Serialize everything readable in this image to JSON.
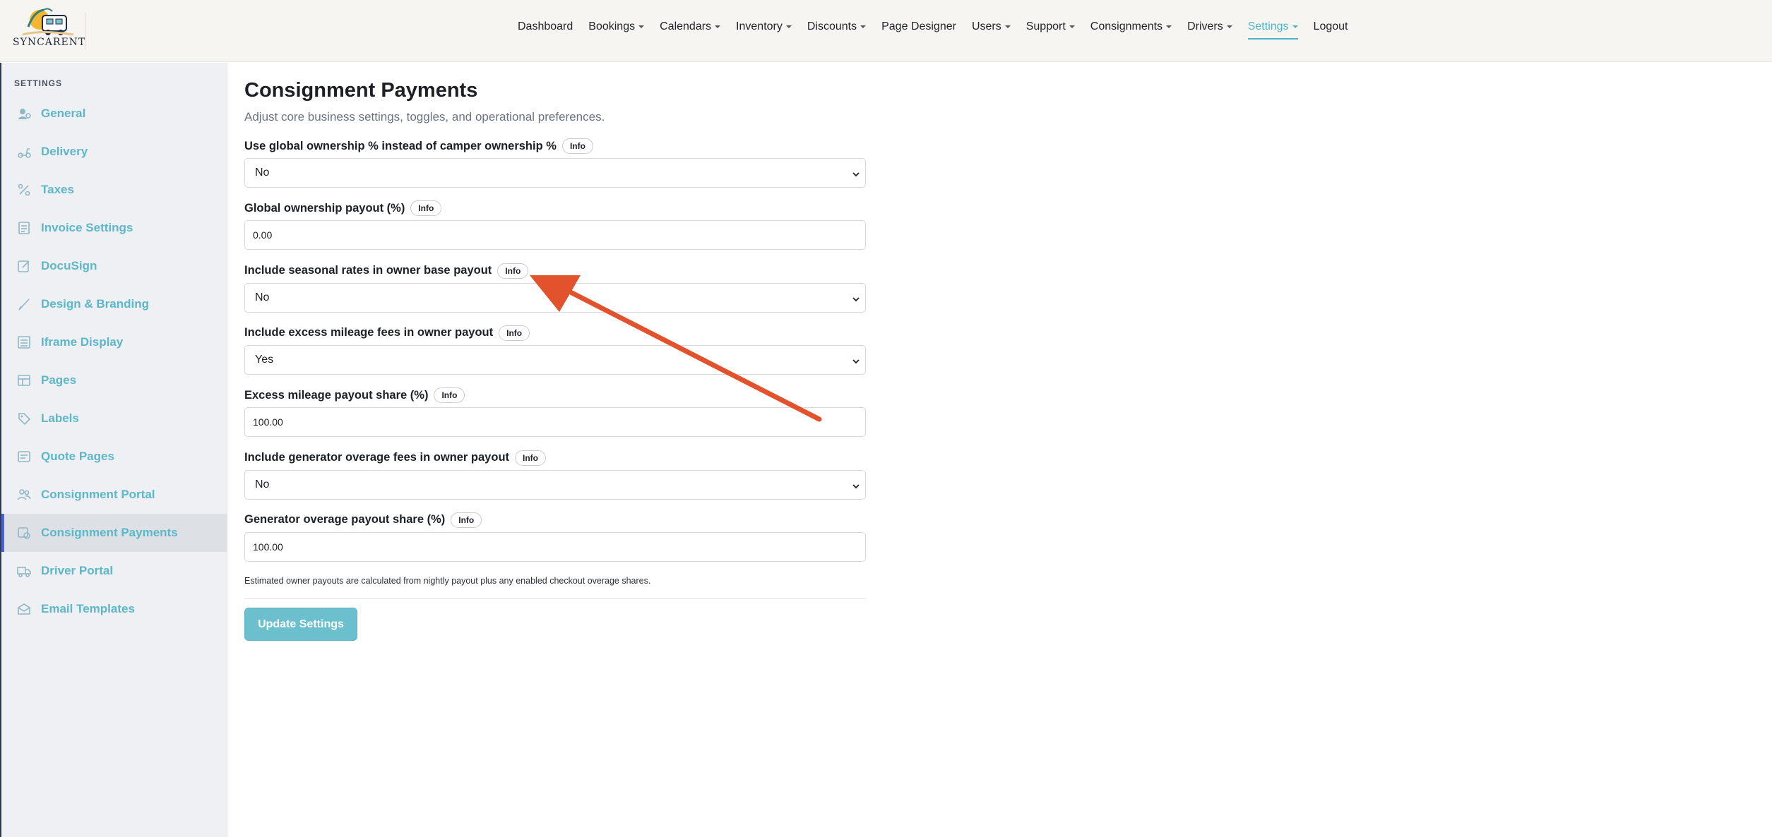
{
  "brand": {
    "name": "SYNCARENT"
  },
  "nav": {
    "items": [
      {
        "label": "Dashboard",
        "caret": false,
        "active": false
      },
      {
        "label": "Bookings",
        "caret": true,
        "active": false
      },
      {
        "label": "Calendars",
        "caret": true,
        "active": false
      },
      {
        "label": "Inventory",
        "caret": true,
        "active": false
      },
      {
        "label": "Discounts",
        "caret": true,
        "active": false
      },
      {
        "label": "Page Designer",
        "caret": false,
        "active": false
      },
      {
        "label": "Users",
        "caret": true,
        "active": false
      },
      {
        "label": "Support",
        "caret": true,
        "active": false
      },
      {
        "label": "Consignments",
        "caret": true,
        "active": false
      },
      {
        "label": "Drivers",
        "caret": true,
        "active": false
      },
      {
        "label": "Settings",
        "caret": true,
        "active": true
      },
      {
        "label": "Logout",
        "caret": false,
        "active": false
      }
    ]
  },
  "sidebar": {
    "heading": "SETTINGS",
    "items": [
      {
        "label": "General",
        "icon": "user-cog-icon",
        "active": false
      },
      {
        "label": "Delivery",
        "icon": "scooter-icon",
        "active": false
      },
      {
        "label": "Taxes",
        "icon": "percent-icon",
        "active": false
      },
      {
        "label": "Invoice Settings",
        "icon": "invoice-icon",
        "active": false
      },
      {
        "label": "DocuSign",
        "icon": "pen-square-icon",
        "active": false
      },
      {
        "label": "Design & Branding",
        "icon": "brush-icon",
        "active": false
      },
      {
        "label": "Iframe Display",
        "icon": "list-window-icon",
        "active": false
      },
      {
        "label": "Pages",
        "icon": "layout-icon",
        "active": false
      },
      {
        "label": "Labels",
        "icon": "tag-icon",
        "active": false
      },
      {
        "label": "Quote Pages",
        "icon": "quote-icon",
        "active": false
      },
      {
        "label": "Consignment Portal",
        "icon": "users-icon",
        "active": false
      },
      {
        "label": "Consignment Payments",
        "icon": "payment-icon",
        "active": true
      },
      {
        "label": "Driver Portal",
        "icon": "truck-icon",
        "active": false
      },
      {
        "label": "Email Templates",
        "icon": "envelope-icon",
        "active": false
      }
    ]
  },
  "main": {
    "title": "Consignment Payments",
    "subtitle": "Adjust core business settings, toggles, and operational preferences.",
    "info_label": "Info",
    "fields": [
      {
        "label": "Use global ownership % instead of camper ownership %",
        "type": "select",
        "value": "No"
      },
      {
        "label": "Global ownership payout (%)",
        "type": "input",
        "value": "0.00"
      },
      {
        "label": "Include seasonal rates in owner base payout",
        "type": "select",
        "value": "No"
      },
      {
        "label": "Include excess mileage fees in owner payout",
        "type": "select",
        "value": "Yes"
      },
      {
        "label": "Excess mileage payout share (%)",
        "type": "input",
        "value": "100.00"
      },
      {
        "label": "Include generator overage fees in owner payout",
        "type": "select",
        "value": "No"
      },
      {
        "label": "Generator overage payout share (%)",
        "type": "input",
        "value": "100.00"
      }
    ],
    "helper": "Estimated owner payouts are calculated from nightly payout plus any enabled checkout overage shares.",
    "submit_label": "Update Settings"
  },
  "colors": {
    "accent": "#4fb3c7",
    "button": "#6cbfcd",
    "annotation_arrow": "#e2522c",
    "active_indicator": "#4d62d1"
  }
}
